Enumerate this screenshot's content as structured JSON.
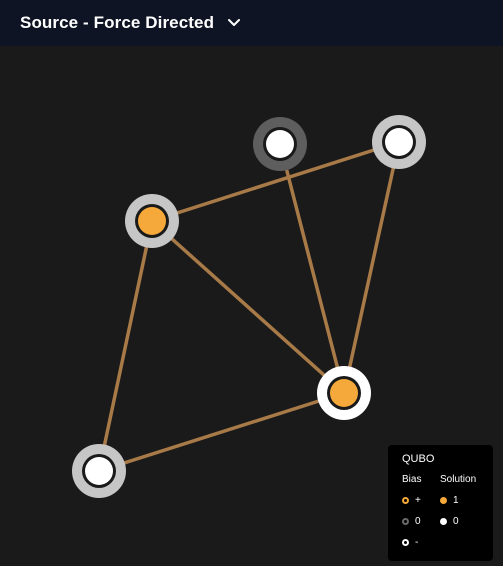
{
  "header": {
    "title": "Source - Force Directed"
  },
  "colors": {
    "background": "#1a1a1a",
    "header_bg": "#0e1423",
    "edge": "#a87a48",
    "solution_one": "#f5a93a",
    "solution_zero": "#ffffff"
  },
  "graph": {
    "nodes": [
      {
        "id": "n1",
        "bias": "0",
        "solution": 0
      },
      {
        "id": "n2",
        "bias": "+",
        "solution": 0
      },
      {
        "id": "n3",
        "bias": "+",
        "solution": 1
      },
      {
        "id": "n4",
        "bias": "-",
        "solution": 1
      },
      {
        "id": "n5",
        "bias": "+",
        "solution": 0
      }
    ],
    "edges": [
      [
        "n3",
        "n2"
      ],
      [
        "n3",
        "n4"
      ],
      [
        "n3",
        "n5"
      ],
      [
        "n1",
        "n4"
      ],
      [
        "n2",
        "n4"
      ],
      [
        "n5",
        "n4"
      ]
    ]
  },
  "legend": {
    "title": "QUBO",
    "bias_header": "Bias",
    "solution_header": "Solution",
    "bias_items": [
      "+",
      "0",
      "-"
    ],
    "solution_items": [
      "1",
      "0"
    ]
  }
}
